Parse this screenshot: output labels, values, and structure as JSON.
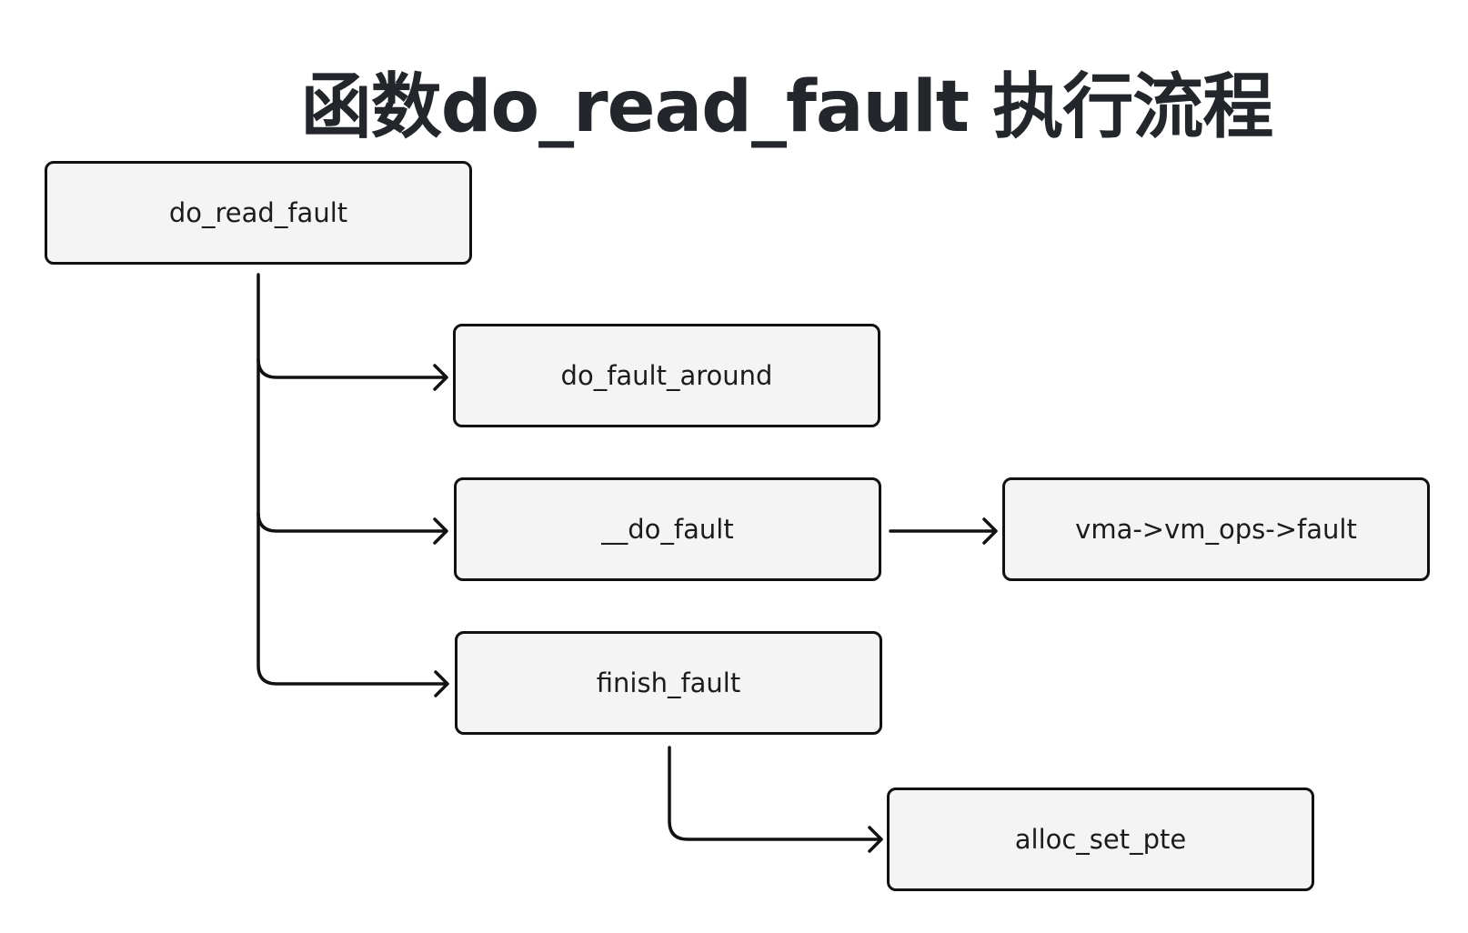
{
  "title": "函数do_read_fault 执行流程",
  "nodes": {
    "do_read_fault": "do_read_fault",
    "do_fault_around": "do_fault_around",
    "__do_fault": "__do_fault",
    "vm_ops_fault": "vma->vm_ops->fault",
    "finish_fault": "finish_fault",
    "alloc_set_pte": "alloc_set_pte"
  },
  "edges": [
    {
      "from": "do_read_fault",
      "to": "do_fault_around"
    },
    {
      "from": "do_read_fault",
      "to": "__do_fault"
    },
    {
      "from": "do_read_fault",
      "to": "finish_fault"
    },
    {
      "from": "__do_fault",
      "to": "vma->vm_ops->fault"
    },
    {
      "from": "finish_fault",
      "to": "alloc_set_pte"
    }
  ]
}
